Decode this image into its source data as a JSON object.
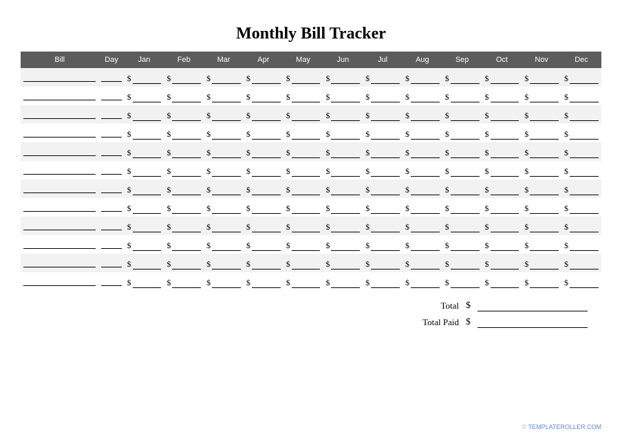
{
  "title": "Monthly Bill Tracker",
  "columns": [
    "Bill",
    "Day",
    "Jan",
    "Feb",
    "Mar",
    "Apr",
    "May",
    "Jun",
    "Jul",
    "Aug",
    "Sep",
    "Oct",
    "Nov",
    "Dec"
  ],
  "currency_symbol": "$",
  "row_count": 12,
  "totals": {
    "total_label": "Total",
    "total_paid_label": "Total Paid"
  },
  "footer": {
    "prefix": "© ",
    "link_text": "TEMPLATEROLLER.COM"
  }
}
